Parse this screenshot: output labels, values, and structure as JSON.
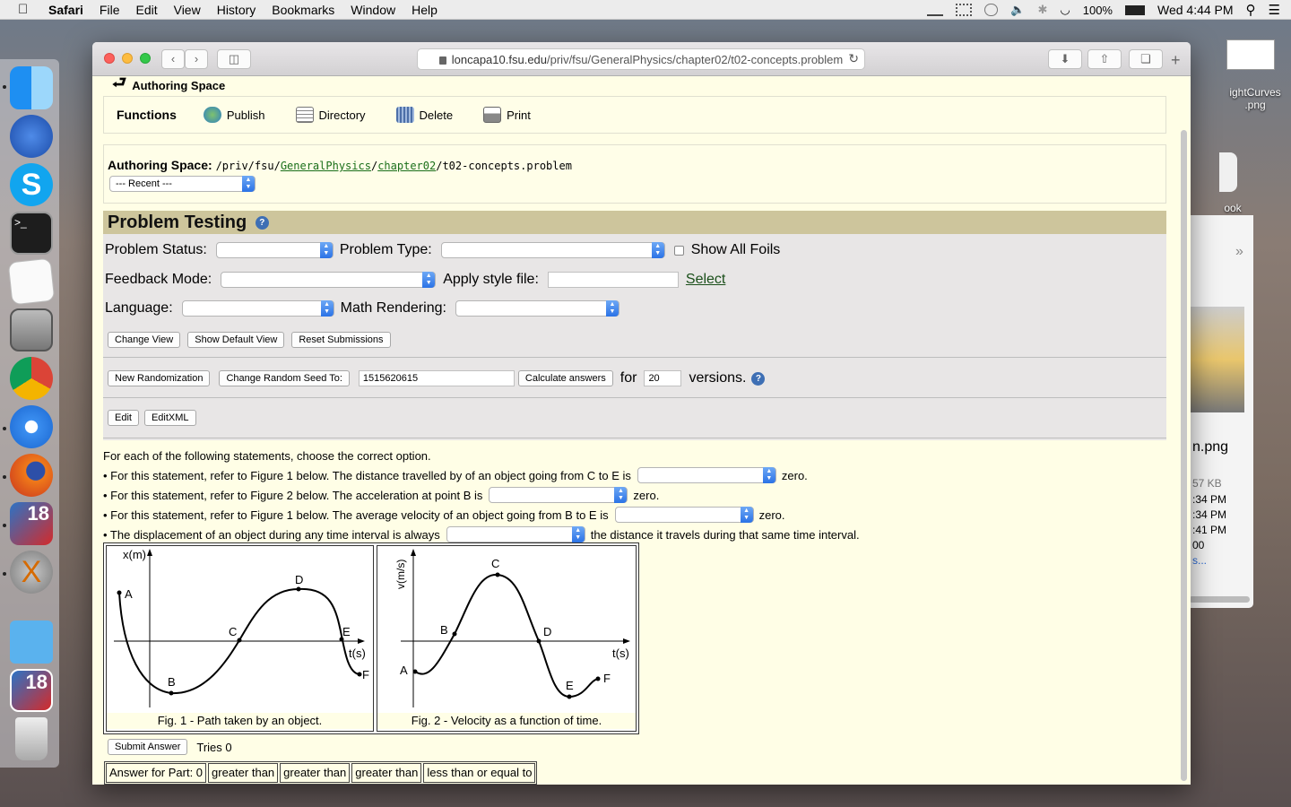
{
  "menubar": {
    "app": "Safari",
    "items": [
      "File",
      "Edit",
      "View",
      "History",
      "Bookmarks",
      "Window",
      "Help"
    ],
    "battery": "100%",
    "clock": "Wed 4:44 PM"
  },
  "desktop": {
    "file1": "ightCurves\n.png",
    "file2": "ook",
    "finder_name": "n.png",
    "finder_size": "57 KB",
    "finder_t1": ":34 PM",
    "finder_t2": ":34 PM",
    "finder_t3": ":41 PM",
    "finder_t4": "00",
    "finder_more": "s..."
  },
  "browser": {
    "url_host": "loncapa10.fsu.edu",
    "url_path": "/priv/fsu/GeneralPhysics/chapter02/t02-concepts.problem"
  },
  "header": {
    "authoring_link": "Authoring Space"
  },
  "functions": {
    "label": "Functions",
    "publish": "Publish",
    "directory": "Directory",
    "delete": "Delete",
    "print": "Print"
  },
  "authoring": {
    "label": "Authoring Space:",
    "path_prefix": "/priv/fsu/",
    "seg1": "GeneralPhysics",
    "seg2": "chapter02",
    "filename": "/t02-concepts.problem",
    "recent": "--- Recent ---"
  },
  "testing": {
    "title": "Problem Testing",
    "help": "?",
    "problem_status": "Problem Status:",
    "problem_type": "Problem Type:",
    "show_all_foils": "Show All Foils",
    "feedback_mode": "Feedback Mode:",
    "apply_style": "Apply style file:",
    "select_link": "Select",
    "language": "Language:",
    "math_rendering": "Math Rendering:",
    "change_view": "Change View",
    "show_default_view": "Show Default View",
    "reset_submissions": "Reset Submissions",
    "new_randomization": "New Randomization",
    "change_seed": "Change Random Seed To:",
    "seed_value": "1515620615",
    "calculate_answers": "Calculate answers",
    "for": "for",
    "versions_value": "20",
    "versions": "versions.",
    "edit": "Edit",
    "edit_xml": "EditXML"
  },
  "problem": {
    "intro": "For each of the following statements, choose the correct option.",
    "s1_pre": "• For this statement, refer to Figure 1 below. The distance travelled by of an object going from C to E is",
    "s1_post": "zero.",
    "s2_pre": "• For this statement, refer to Figure 2 below. The acceleration at point B is",
    "s2_post": "zero.",
    "s3_pre": "• For this statement, refer to Figure 1 below. The average velocity of an object going from B to E is",
    "s3_post": "zero.",
    "s4_pre": "• The displacement of an object during any time interval is always",
    "s4_post": "the distance it travels during that same time interval."
  },
  "figures": {
    "fig1": {
      "ylabel": "x(m)",
      "xlabel": "t(s)",
      "caption": "Fig. 1 - Path taken by an object.",
      "labels": {
        "A": "A",
        "B": "B",
        "C": "C",
        "D": "D",
        "E": "E",
        "F": "F"
      }
    },
    "fig2": {
      "ylabel": "v(m/s)",
      "xlabel": "t(s)",
      "caption": "Fig. 2 - Velocity as a function of time.",
      "labels": {
        "A": "A",
        "B": "B",
        "C": "C",
        "D": "D",
        "E": "E",
        "F": "F"
      }
    }
  },
  "submit": {
    "button": "Submit Answer",
    "tries": "Tries 0"
  },
  "answers": {
    "label": "Answer for Part: 0",
    "a1": "greater than",
    "a2": "greater than",
    "a3": "greater than",
    "a4": "less than or equal to"
  }
}
